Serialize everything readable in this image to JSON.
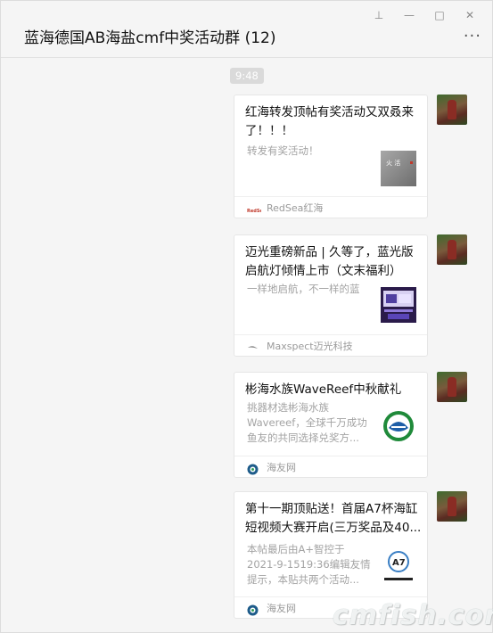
{
  "window": {
    "controls": {
      "pin": "⊥",
      "minimize": "—",
      "maximize": "□",
      "close": "✕"
    }
  },
  "header": {
    "title": "蓝海德国AB海盐cmf中奖活动群 (12)",
    "more": "···"
  },
  "timestamp": "9:48",
  "messages": [
    {
      "title": "红海转发顶帖有奖活动又双叒来了！！！",
      "desc": "转发有奖活动！",
      "source": "RedSea红海",
      "thumb_icon": "redsea-thumbnail-icon",
      "source_icon": "redsea-logo-icon"
    },
    {
      "title": "迈光重磅新品 | 久等了，蓝光版启航灯倾情上市（文末福利）",
      "desc": "一样地启航，不一样的蓝",
      "source": "Maxspect迈光科技",
      "thumb_icon": "maxspect-thumbnail-icon",
      "source_icon": "maxspect-logo-icon"
    },
    {
      "title": "彬海水族WaveReef中秋献礼",
      "desc": "挑器材选彬海水族Wavereef，全球千万成功鱼友的共同选择兑奖方...",
      "source": "海友网",
      "thumb_icon": "wavereef-thumbnail-icon",
      "source_icon": "haiyouwang-logo-icon"
    },
    {
      "title": "第十一期顶贴送！首届A7杯海缸短视频大赛开启(三万奖品及40...",
      "desc": "本帖最后由A+智控于2021-9-1519:36编辑友情提示，本贴共两个活动...",
      "source": "海友网",
      "thumb_icon": "a7-thumbnail-icon",
      "source_icon": "haiyouwang-logo-icon"
    }
  ],
  "watermark": "cmfish.com",
  "colors": {
    "background": "#f5f5f5",
    "card": "#ffffff",
    "time_badge": "#dadada",
    "wavereef_green": "#1f8a3a",
    "wavereef_blue": "#1f5fa8"
  }
}
